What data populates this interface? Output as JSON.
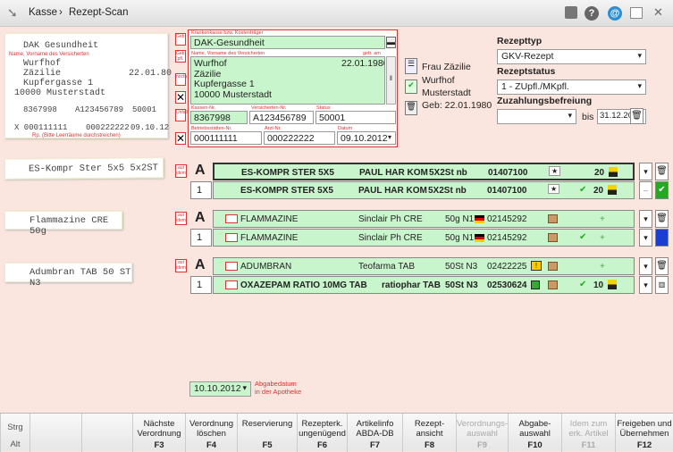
{
  "breadcrumb": {
    "root": "Kasse",
    "sep": "›",
    "current": "Rezept-Scan"
  },
  "scan": {
    "insurer": "DAK Gesundheit",
    "name1": "Wurfhof",
    "name2": "Zäzilie",
    "dob": "22.01.80",
    "street": "Kupfergasse 1",
    "city": "10000 Musterstadt",
    "kasse": "8367998",
    "versnr": "A123456789",
    "status": "50001",
    "betrieb": "X 000111111",
    "arzt": "000222222",
    "datum": "09.10.12",
    "lbl_kk": "Krankenkasse bzw. Kostenträger",
    "lbl_name": "Name, Vorname des Versicherten",
    "lbl_geb": "geb. am",
    "lbl_kassennr": "Kassen-Nr.",
    "lbl_versnr": "Versicherten-Nr.",
    "lbl_status": "Status",
    "lbl_betrieb": "Betriebsstätten-Nr.",
    "lbl_arzt": "Arzt-Nr.",
    "lbl_datum": "Datum",
    "rp_note": "Rp. (Bitte Leerräume durchstreichen)"
  },
  "form": {
    "lbl_kk": "Krankenkasse bzw. Kostenträger",
    "kk": "DAK-Gesundheit",
    "lbl_name": "Name, Vorname des Versicherten",
    "lbl_geb": "geb. am",
    "name1": "Wurfhof",
    "dob": "22.01.1980",
    "name2": "Zäzilie",
    "street": "Kupfergasse 1",
    "city": "10000 Musterstadt",
    "lbl_kassennr": "Kassen-Nr.",
    "kassennr": "8367998",
    "lbl_versnr": "Versicherten-Nr.",
    "versnr": "A123456789",
    "lbl_status": "Status",
    "status": "50001",
    "lbl_betrieb": "Betriebsstätten-Nr.",
    "betrieb": "000111111",
    "lbl_arzt": "Arzt-Nr.",
    "arzt": "000222222",
    "lbl_datum": "Datum",
    "datum": "09.10.2012",
    "side_geb": "Geb.",
    "side_pflicht": "Geb. pfl.",
    "side_noctu": "noctu",
    "side_sonst": "Sonst.",
    "side_unfall": "Unfall",
    "side_arbeit": "Arbeits-unfall"
  },
  "patient": {
    "salutation": "Frau Zäzilie",
    "lastname": "Wurfhof",
    "city": "Musterstadt",
    "birth": "Geb: 22.01.1980"
  },
  "rezept": {
    "typ_label": "Rezepttyp",
    "typ_value": "GKV-Rezept",
    "status_label": "Rezeptstatus",
    "status_value": "1 - ZUpfl./MKpfl.",
    "zuz_label": "Zuzahlungsbefreiung",
    "zuz_from": "",
    "zuz_bis": "bis",
    "zuz_to": "31.12.2011"
  },
  "items": [
    {
      "scan_text": "ES-Kompr Ster 5x5 5x2ST",
      "aut": "aut idem",
      "A": "A",
      "row1": {
        "name": "ES-KOMPR STER 5X5",
        "maker": "PAUL HAR KOM",
        "size": "5X2St nb",
        "pzn": "01407100",
        "qty": "20"
      },
      "row2": {
        "num": "1",
        "name": "ES-KOMPR STER 5X5",
        "maker": "PAUL HAR KOM",
        "size": "5X2St nb",
        "pzn": "01407100",
        "qty": "20"
      }
    },
    {
      "scan_text": "Flammazine CRE 50g",
      "aut": "aut idem",
      "A": "A",
      "row1": {
        "name": "FLAMMAZINE",
        "maker": "Sinclair Ph CRE",
        "size": "50g N1",
        "pzn": "02145292",
        "qty": ""
      },
      "row2": {
        "num": "1",
        "name": "FLAMMAZINE",
        "maker": "Sinclair Ph CRE",
        "size": "50g N1",
        "pzn": "02145292",
        "qty": ""
      }
    },
    {
      "scan_text": "Adumbran TAB 50 ST N3",
      "aut": "aut idem",
      "A": "A",
      "row1": {
        "name": "ADUMBRAN",
        "maker": "Teofarma TAB",
        "size": "50St N3",
        "pzn": "02422225",
        "qty": ""
      },
      "row2": {
        "num": "1",
        "name": "OXAZEPAM RATIO 10MG TAB",
        "maker": "ratiophar TAB",
        "size": "50St N3",
        "pzn": "02530624",
        "qty": "10"
      }
    }
  ],
  "abgabe": {
    "date": "10.10.2012",
    "label1": "Abgabedatum",
    "label2": "in der Apotheke"
  },
  "fkeys": [
    {
      "top": "Strg",
      "bot": "Alt"
    },
    {
      "l1": "Nächste",
      "l2": "Verordnung",
      "k": "F3"
    },
    {
      "l1": "Verordnung",
      "l2": "löschen",
      "k": "F4"
    },
    {
      "l1": "Reservierung",
      "l2": "",
      "k": "F5"
    },
    {
      "l1": "Rezepterk.",
      "l2": "ungenügend",
      "k": "F6"
    },
    {
      "l1": "Artikelinfo",
      "l2": "ABDA-DB",
      "k": "F7"
    },
    {
      "l1": "Rezept-",
      "l2": "ansicht",
      "k": "F8"
    },
    {
      "l1": "Verordnungs-",
      "l2": "auswahl",
      "k": "F9"
    },
    {
      "l1": "Abgabe-",
      "l2": "auswahl",
      "k": "F10"
    },
    {
      "l1": "Idem zum",
      "l2": "erk. Artikel",
      "k": "F11"
    },
    {
      "l1": "Freigeben und",
      "l2": "Übernehmen",
      "k": "F12"
    }
  ],
  "colors": {
    "bg": "#fbe5df",
    "green": "#c8f5cc",
    "red": "#d33333",
    "accent": "#2a8fd6"
  }
}
